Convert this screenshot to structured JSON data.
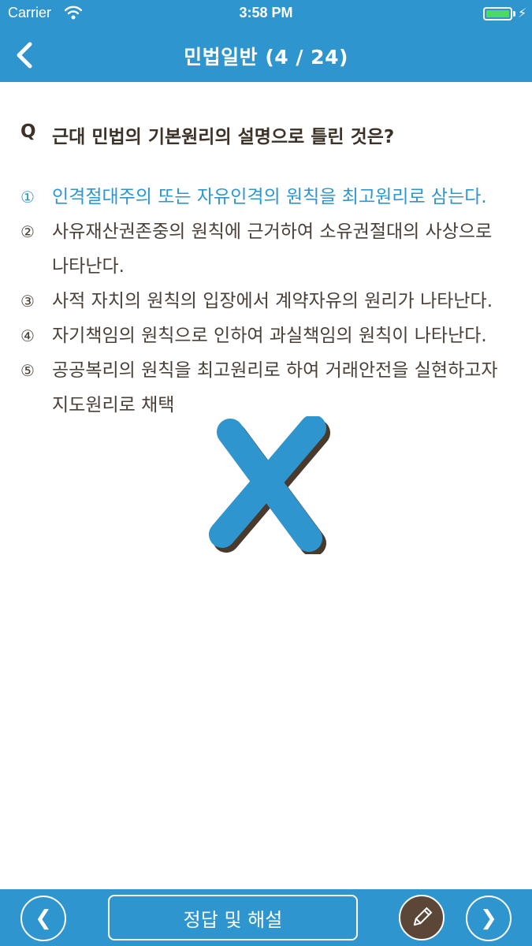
{
  "status_bar": {
    "carrier": "Carrier",
    "time": "3:58 PM"
  },
  "header": {
    "title": "민법일반 (4 / 24)",
    "back_icon": "chevron-left-icon"
  },
  "question": {
    "label": "Q",
    "text": "근대 민법의 기본원리의 설명으로 틀린 것은?"
  },
  "choices": [
    {
      "num": "①",
      "text": "인격절대주의 또는 자유인격의 원칙을 최고원리로 삼는다."
    },
    {
      "num": "②",
      "text": "사유재산권존중의 원칙에 근거하여 소유권절대의 사상으로 나타난다."
    },
    {
      "num": "③",
      "text": "사적 자치의 원칙의 입장에서 계약자유의 원리가 나타난다."
    },
    {
      "num": "④",
      "text": "자기책임의 원칙으로 인하여 과실책임의 원칙이 나타난다."
    },
    {
      "num": "⑤",
      "text": "공공복리의 원칙을 최고원리로 하여 거래안전을 실현하고자 지도원리로 채택"
    }
  ],
  "highlighted_choice": 1,
  "result_mark": "wrong-x-icon",
  "colors": {
    "accent": "#2e95cf",
    "text": "#4a4038",
    "memo": "#5b4637",
    "battery": "#4cd964"
  },
  "toolbar": {
    "prev_label": "❮",
    "answer_label": "정답 및 해설",
    "next_label": "❯",
    "memo_icon": "pencil-icon"
  }
}
